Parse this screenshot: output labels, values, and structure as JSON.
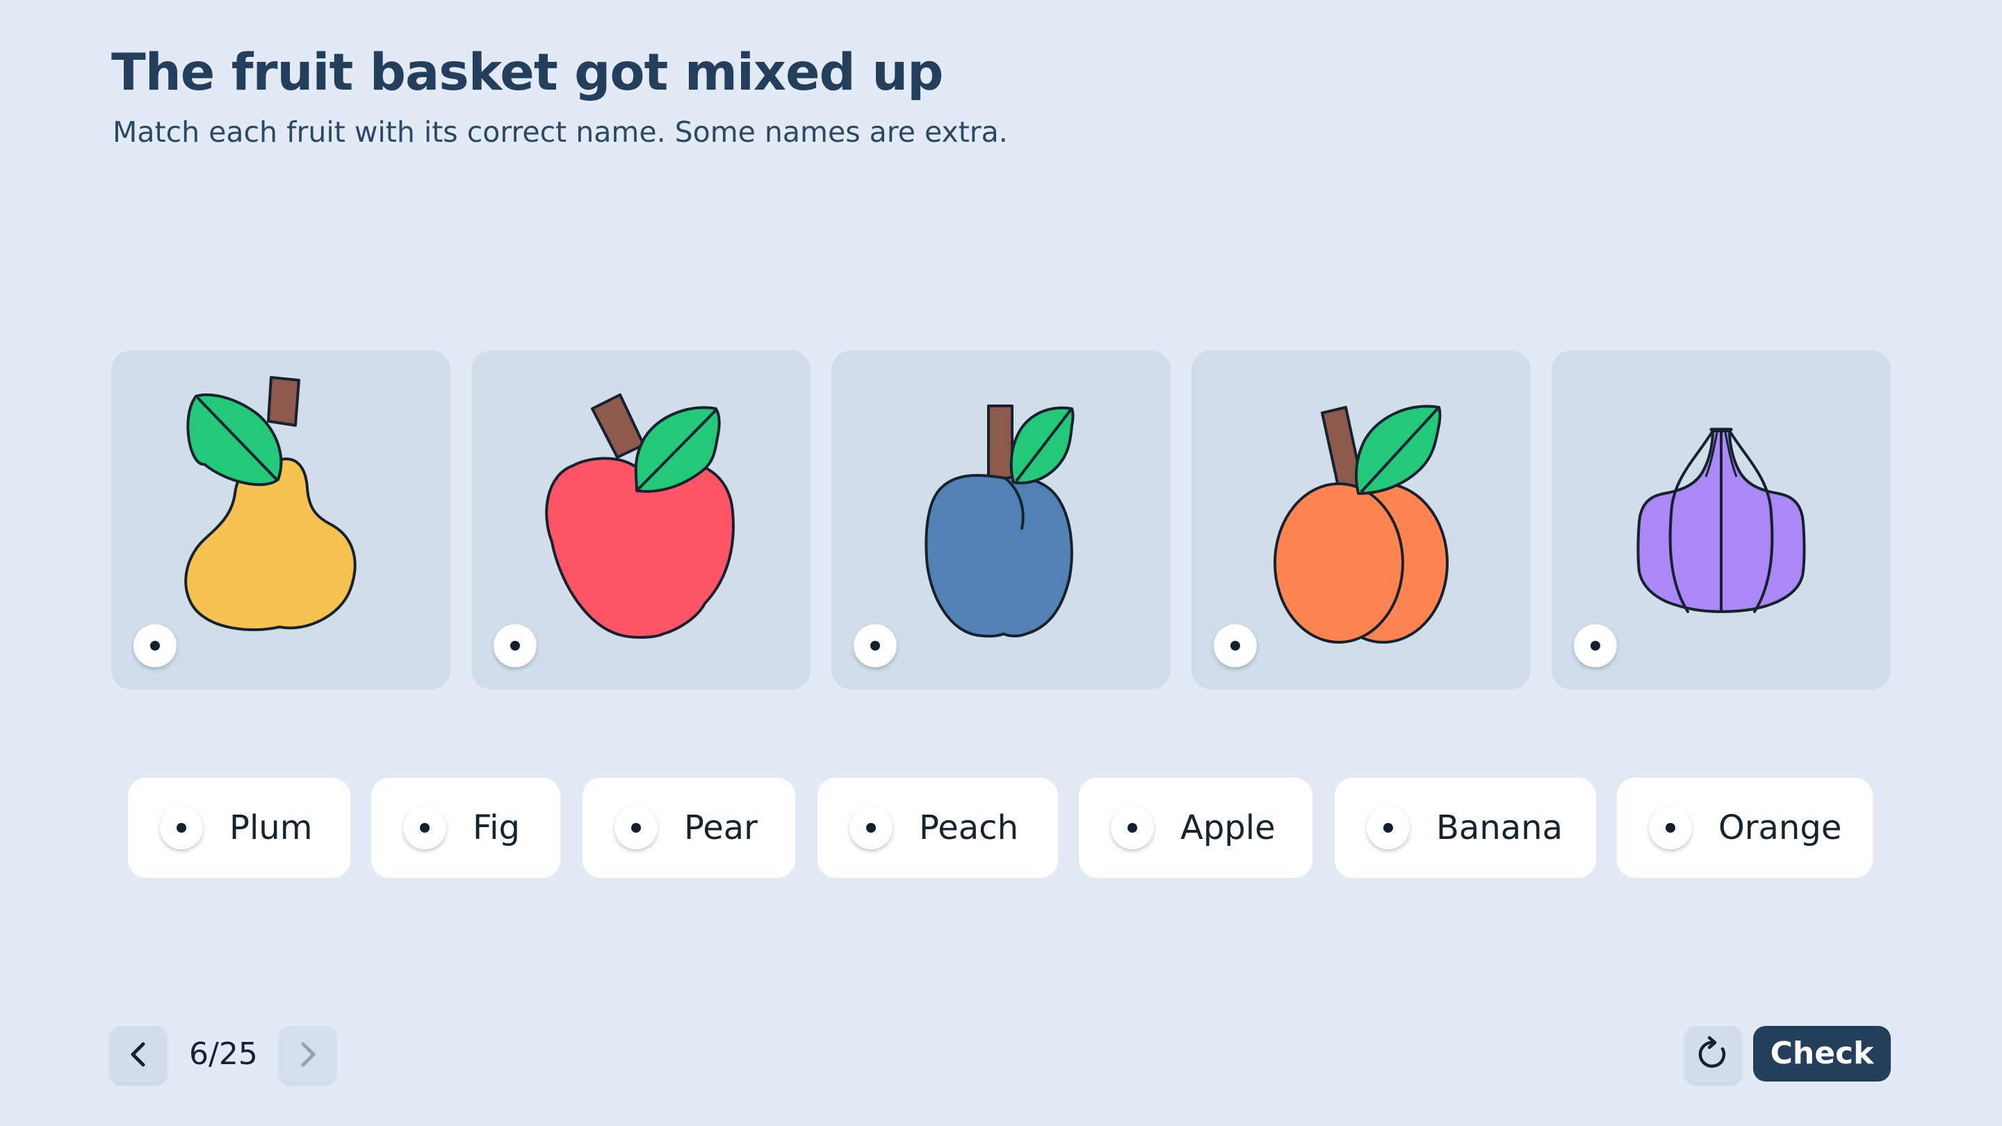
{
  "header": {
    "title": "The fruit basket got mixed up",
    "subtitle": "Match each fruit with its correct name. Some names are extra."
  },
  "fruit_cards": [
    {
      "fruit_icon": "pear-icon",
      "color": "#f6c350"
    },
    {
      "fruit_icon": "apple-icon",
      "color": "#ff5366"
    },
    {
      "fruit_icon": "plum-icon",
      "color": "#5282b5"
    },
    {
      "fruit_icon": "peach-icon",
      "color": "#ff8451"
    },
    {
      "fruit_icon": "fig-icon",
      "color": "#aa88f6"
    }
  ],
  "name_options": [
    "Plum",
    "Fig",
    "Pear",
    "Peach",
    "Apple",
    "Banana",
    "Orange"
  ],
  "navigation": {
    "page_counter": "6/25",
    "prev_icon": "chevron-left-icon",
    "next_icon": "chevron-right-icon",
    "reset_icon": "refresh-icon",
    "check_label": "Check"
  },
  "colors": {
    "background": "#e2ebf5",
    "card": "#d1deea",
    "primary": "#243f5c",
    "leaf": "#23c879",
    "stem": "#8e5a4e"
  }
}
